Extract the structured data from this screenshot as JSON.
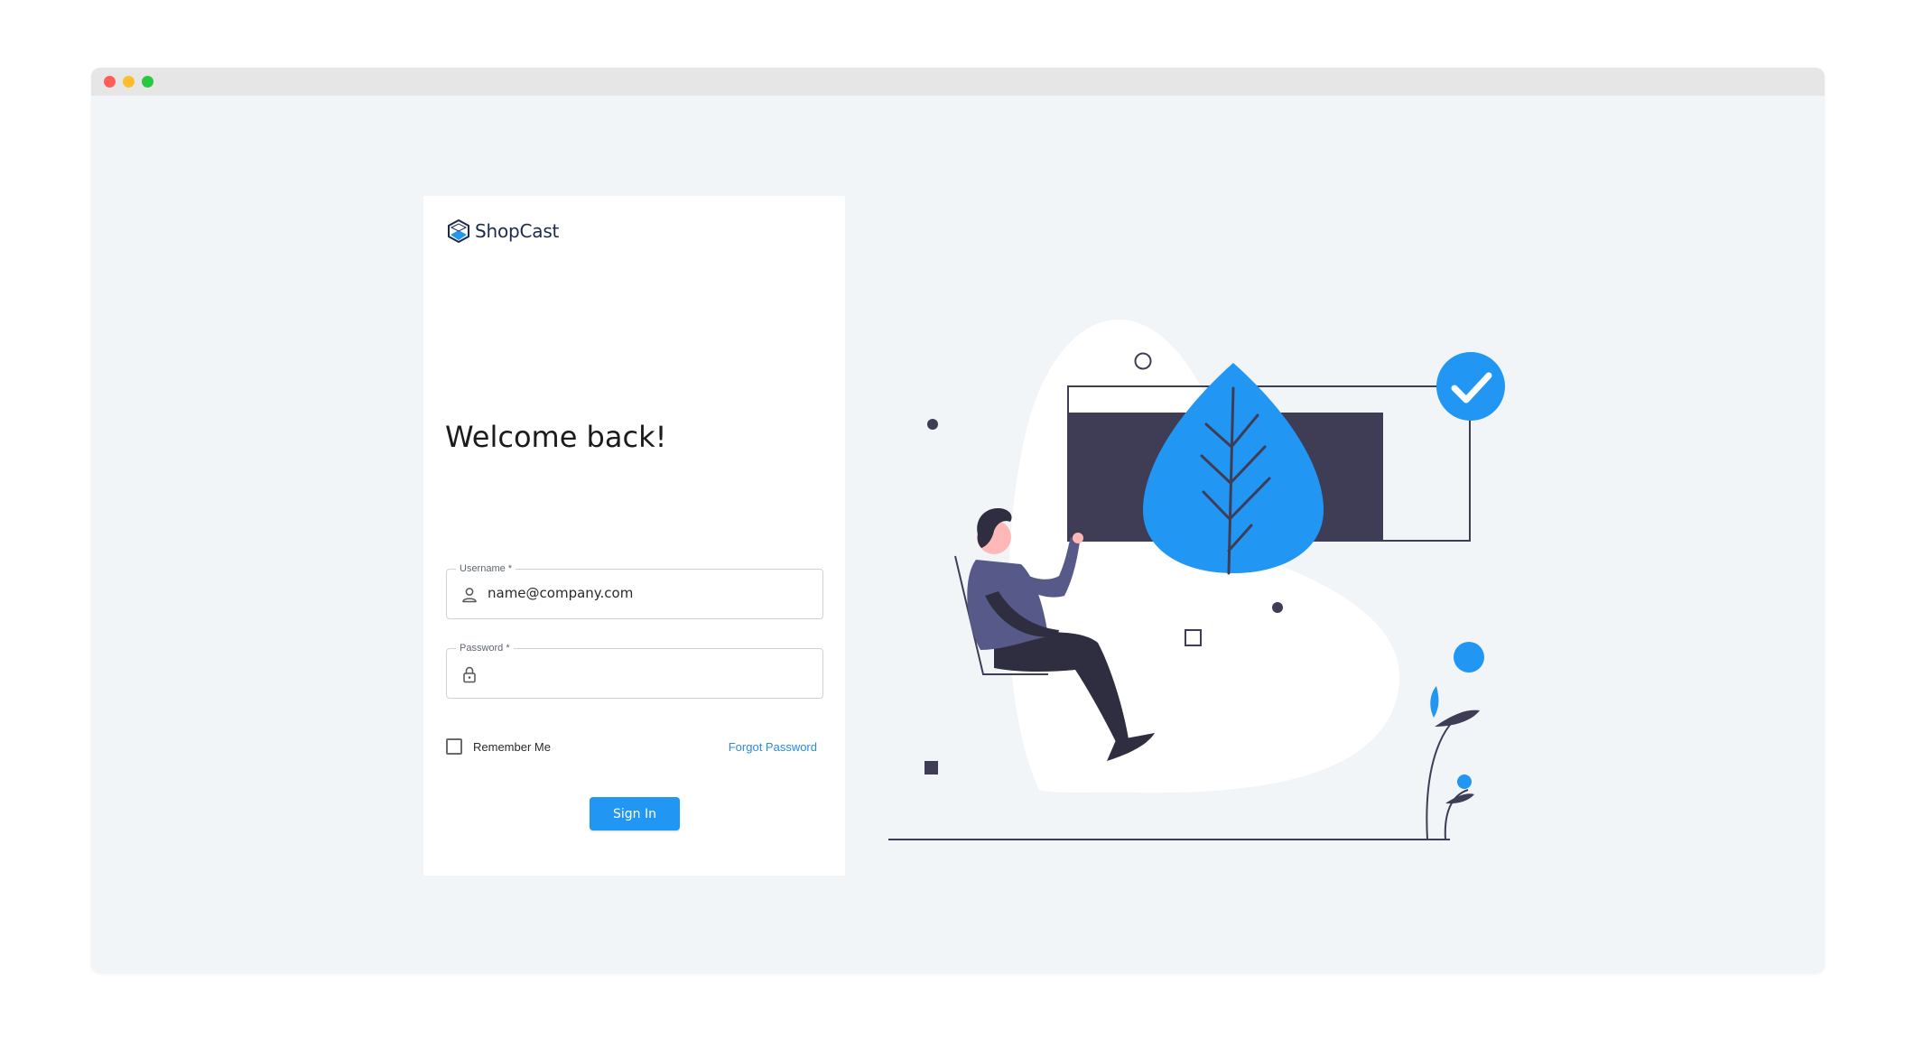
{
  "window": {
    "controls": [
      "close",
      "minimize",
      "maximize"
    ]
  },
  "brand": {
    "name": "ShopCast",
    "logo_icon": "hexagon-logo-icon",
    "color": "#1e2a4a"
  },
  "login": {
    "title": "Welcome back!",
    "username": {
      "label": "Username *",
      "value": "name@company.com",
      "icon": "user-icon"
    },
    "password": {
      "label": "Password *",
      "value": "",
      "icon": "lock-icon"
    },
    "remember_label": "Remember Me",
    "remember_checked": false,
    "forgot_label": "Forgot Password",
    "submit_label": "Sign In"
  },
  "colors": {
    "accent": "#2196f3",
    "background": "#f2f5f8",
    "illustration_dark": "#3f3d56"
  },
  "illustration": {
    "badge_icon": "check-icon"
  }
}
